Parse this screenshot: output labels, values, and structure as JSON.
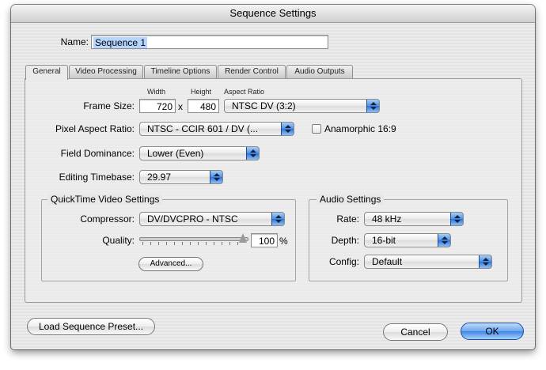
{
  "window": {
    "title": "Sequence Settings"
  },
  "name_field": {
    "label": "Name:",
    "value": "Sequence 1"
  },
  "tabs": [
    {
      "label": "General",
      "active": true
    },
    {
      "label": "Video Processing"
    },
    {
      "label": "Timeline Options"
    },
    {
      "label": "Render Control"
    },
    {
      "label": "Audio Outputs"
    }
  ],
  "general": {
    "col_width": "Width",
    "col_height": "Height",
    "col_aspect": "Aspect Ratio",
    "frame_size_label": "Frame Size:",
    "width_value": "720",
    "times": "x",
    "height_value": "480",
    "aspect_ratio_value": "NTSC DV (3:2)",
    "pixel_aspect_label": "Pixel Aspect Ratio:",
    "pixel_aspect_value": "NTSC - CCIR 601 / DV (...",
    "anamorphic_label": "Anamorphic 16:9",
    "anamorphic_checked": false,
    "field_dominance_label": "Field Dominance:",
    "field_dominance_value": "Lower (Even)",
    "editing_timebase_label": "Editing Timebase:",
    "editing_timebase_value": "29.97"
  },
  "quicktime": {
    "title": "QuickTime Video Settings",
    "compressor_label": "Compressor:",
    "compressor_value": "DV/DVCPRO - NTSC",
    "quality_label": "Quality:",
    "quality_value": "100",
    "quality_unit": "%",
    "quality_level": 1.0,
    "advanced_label": "Advanced..."
  },
  "audio": {
    "title": "Audio Settings",
    "rate_label": "Rate:",
    "rate_value": "48 kHz",
    "depth_label": "Depth:",
    "depth_value": "16-bit",
    "config_label": "Config:",
    "config_value": "Default"
  },
  "footer": {
    "load_preset_label": "Load Sequence Preset...",
    "cancel_label": "Cancel",
    "ok_label": "OK"
  },
  "colors": {
    "accent": "#3f86e4",
    "selection": "#b5d5ff"
  }
}
